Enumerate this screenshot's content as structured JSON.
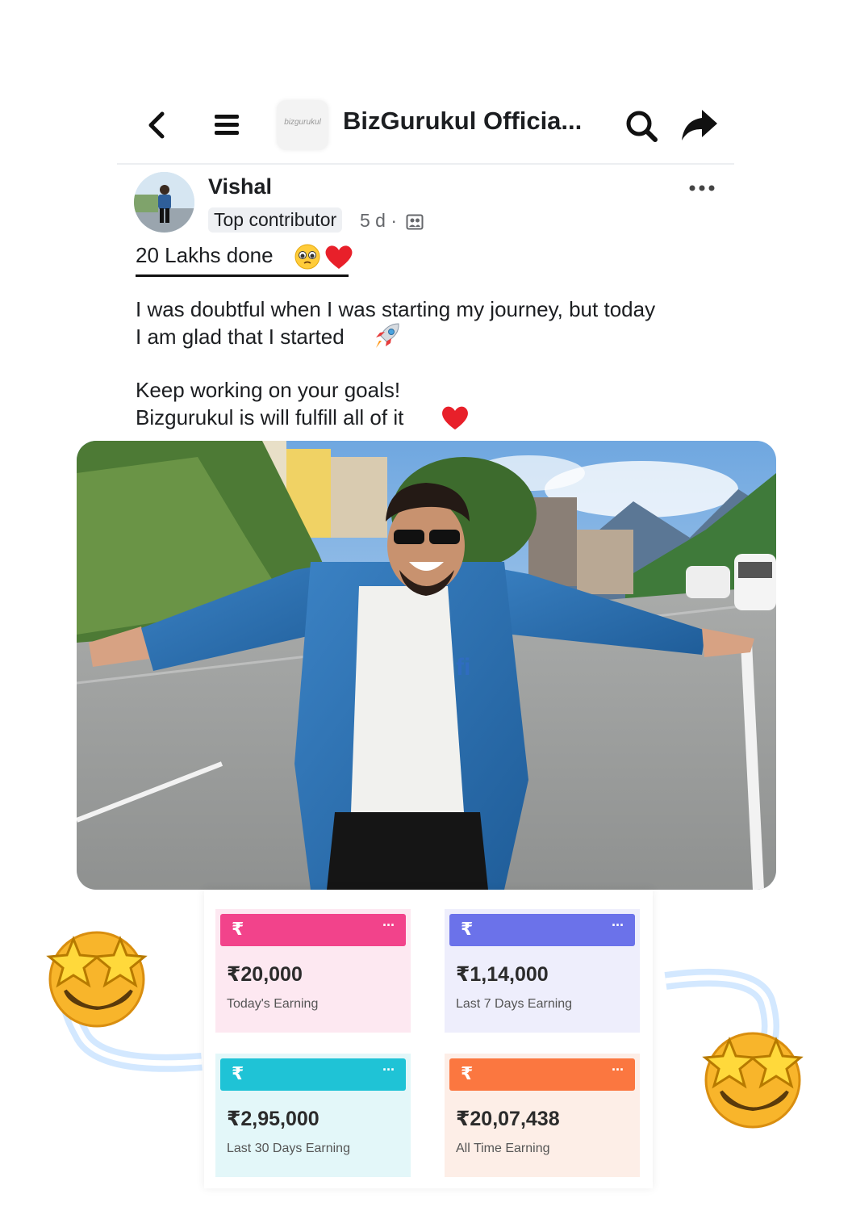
{
  "header": {
    "group_thumb_text": "bizgurukul",
    "title": "BizGurukul Officia..."
  },
  "post": {
    "author": "Vishal",
    "badge": "Top contributor",
    "time": "5 d ·",
    "headline": "20 Lakhs done",
    "paragraph1": [
      "I was doubtful when I was starting my journey, but today",
      "I am glad that I started"
    ],
    "paragraph2": [
      "Keep working on your goals!",
      "Bizgurukul is will fulfill all of it"
    ]
  },
  "earnings": [
    {
      "amount": "₹20,000",
      "label": "Today's Earning",
      "color": "#f2438b",
      "bg": "#fde8f1"
    },
    {
      "amount": "₹1,14,000",
      "label": "Last 7 Days Earning",
      "color": "#6b72ea",
      "bg": "#eeeefc"
    },
    {
      "amount": "₹2,95,000",
      "label": "Last 30 Days Earning",
      "color": "#1fc3d6",
      "bg": "#e3f7f9"
    },
    {
      "amount": "₹20,07,438",
      "label": "All Time Earning",
      "color": "#fb7740",
      "bg": "#fdeee7"
    }
  ],
  "card_icon": "₹",
  "card_menu": "···",
  "icons": [
    "back-icon",
    "menu-icon",
    "search-icon",
    "share-icon",
    "more-icon",
    "privacy-icon",
    "pleading-face-emoji",
    "heart-emoji",
    "rocket-emoji",
    "star-struck-emoji"
  ]
}
